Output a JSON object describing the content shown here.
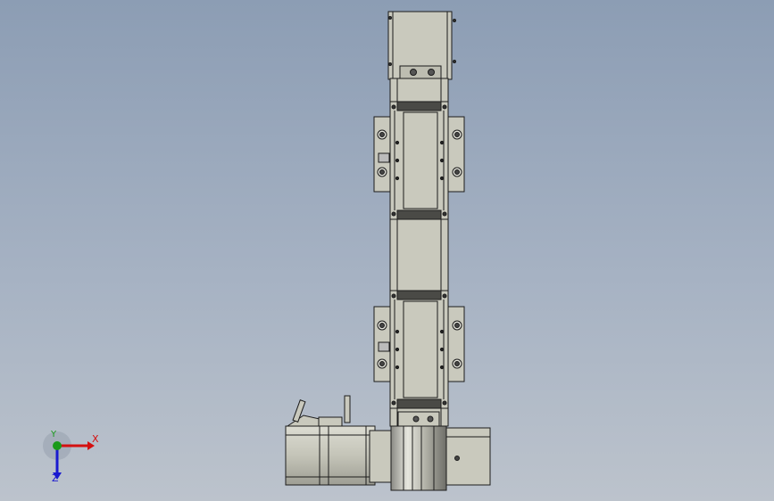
{
  "viewport": {
    "background_top": "#8c9db4",
    "background_bottom": "#bcc3cc"
  },
  "model": {
    "body_color": "#c9c9bd",
    "edge_color": "#1c1c1c",
    "dark_band_color": "#4a4a46"
  },
  "triad": {
    "x_label": "X",
    "y_label": "Y",
    "z_label": "Z",
    "x_color": "#d41010",
    "y_color": "#1a9a1a",
    "z_color": "#1a1ad0"
  }
}
